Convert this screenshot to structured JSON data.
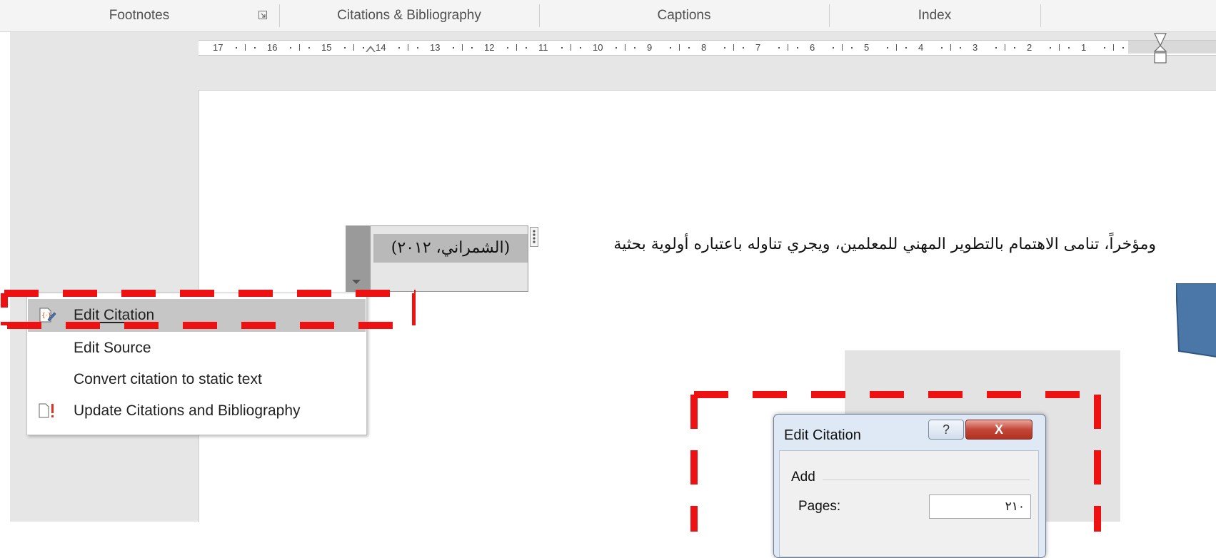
{
  "ribbon": {
    "groups": [
      "Footnotes",
      "Citations & Bibliography",
      "Captions",
      "Index"
    ]
  },
  "ruler": {
    "numbers": [
      "17",
      "16",
      "15",
      "14",
      "13",
      "12",
      "11",
      "10",
      "9",
      "8",
      "7",
      "6",
      "5",
      "4",
      "3",
      "2",
      "1",
      "1"
    ]
  },
  "document": {
    "paragraph": "ومؤخراً، تنامى الاهتمام بالتطوير المهني للمعلمين، ويجري تناوله باعتباره أولوية بحثية",
    "citation": "(الشمراني، ٢٠١٢)"
  },
  "context_menu": {
    "items": [
      {
        "label": "Edit Citation",
        "mnemonic": "E",
        "icon": "edit-citation-icon",
        "highlighted": true
      },
      {
        "label": "Edit Source",
        "mnemonic": "t",
        "icon": null,
        "highlighted": false
      },
      {
        "label": "Convert citation to static text",
        "mnemonic": "C",
        "icon": null,
        "highlighted": false
      },
      {
        "label": "Update Citations and Bibliography",
        "mnemonic": null,
        "icon": "update-bibliography-icon",
        "highlighted": false
      }
    ]
  },
  "dialog": {
    "title": "Edit Citation",
    "help_label": "?",
    "close_label": "X",
    "group_label": "Add",
    "pages_label": "Pages:",
    "pages_value": "٢١٠"
  },
  "colors": {
    "highlight_dashes": "#ee1111",
    "menu_highlight": "#c6c6c6",
    "citation_handle": "#9a9a9a",
    "blue_shape": "#4a76a8"
  }
}
